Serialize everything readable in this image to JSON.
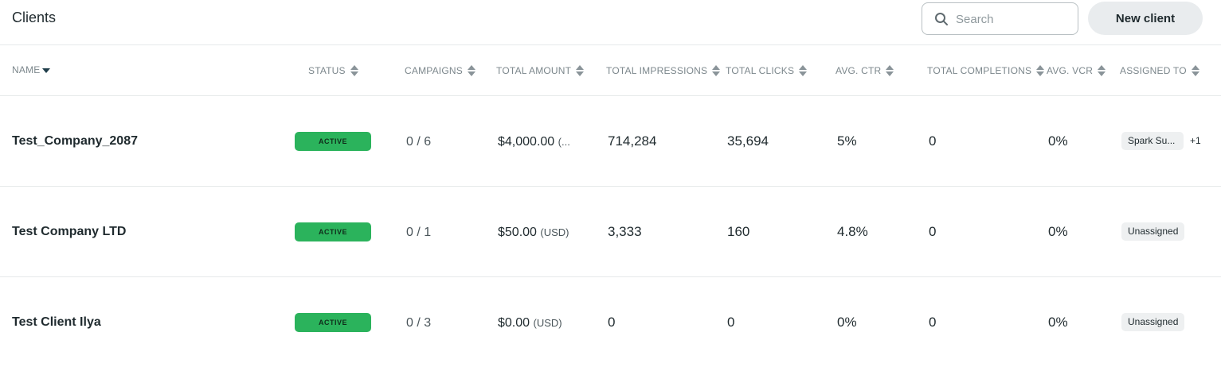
{
  "header": {
    "title": "Clients",
    "search_placeholder": "Search",
    "new_client_label": "New client"
  },
  "columns": {
    "name": "NAME",
    "status": "STATUS",
    "campaigns": "CAMPAIGNS",
    "total_amount": "TOTAL AMOUNT",
    "total_impressions": "TOTAL IMPRESSIONS",
    "total_clicks": "TOTAL CLICKS",
    "avg_ctr": "AVG. CTR",
    "total_completions": "TOTAL COMPLETIONS",
    "avg_vcr": "AVG. VCR",
    "assigned_to": "ASSIGNED TO"
  },
  "rows": [
    {
      "name": "Test_Company_2087",
      "status": "ACTIVE",
      "campaigns": "0 / 6",
      "amount": "$4,000.00",
      "currency": "(...",
      "impressions": "714,284",
      "clicks": "35,694",
      "ctr": "5%",
      "completions": "0",
      "vcr": "0%",
      "assigned": "Spark Su...",
      "assigned_extra": "+1"
    },
    {
      "name": "Test Company LTD",
      "status": "ACTIVE",
      "campaigns": "0 / 1",
      "amount": "$50.00",
      "currency": "(USD)",
      "impressions": "3,333",
      "clicks": "160",
      "ctr": "4.8%",
      "completions": "0",
      "vcr": "0%",
      "assigned": "Unassigned",
      "assigned_extra": ""
    },
    {
      "name": "Test Client Ilya",
      "status": "ACTIVE",
      "campaigns": "0 / 3",
      "amount": "$0.00",
      "currency": "(USD)",
      "impressions": "0",
      "clicks": "0",
      "ctr": "0%",
      "completions": "0",
      "vcr": "0%",
      "assigned": "Unassigned",
      "assigned_extra": ""
    }
  ],
  "icons": {
    "search": "search-icon",
    "sort": "sort-icon",
    "sort_desc": "sort-desc-icon"
  },
  "colors": {
    "status_active": "#2bb35c",
    "button_bg": "#e9ecee"
  }
}
